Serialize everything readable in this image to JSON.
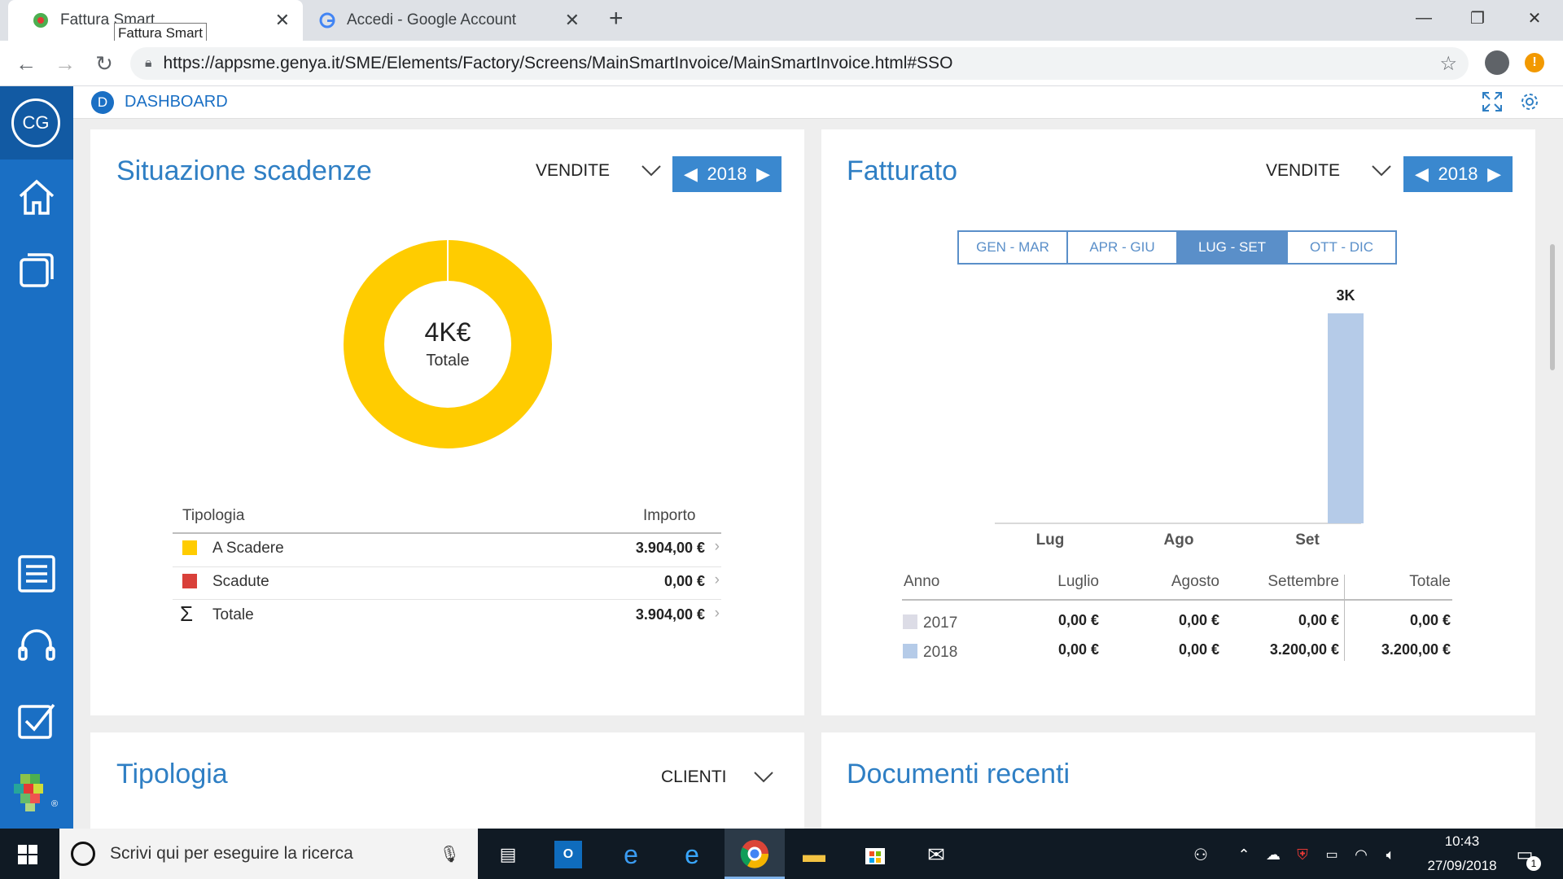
{
  "browser": {
    "tabs": [
      {
        "label": "Fattura Smart",
        "close": "✕"
      },
      {
        "label": "Accedi - Google Account",
        "close": "✕"
      }
    ],
    "new_tab": "+",
    "tooltip": "Fattura Smart",
    "url": "https://appsme.genya.it/SME/Elements/Factory/Screens/MainSmartInvoice/MainSmartInvoice.html#SSO",
    "window_controls": [
      "—",
      "❐",
      "✕"
    ]
  },
  "sidebar": {
    "avatar": "CG",
    "items": [
      "home-icon",
      "pages-icon",
      "list-icon",
      "headset-icon",
      "checkbox-icon"
    ]
  },
  "appbar": {
    "badge": "D",
    "title": "DASHBOARD"
  },
  "scadenze": {
    "title": "Situazione scadenze",
    "filter": "VENDITE",
    "year": "2018",
    "donut_value": "4K€",
    "donut_label": "Totale",
    "col_tipologia": "Tipologia",
    "col_importo": "Importo",
    "rows": [
      {
        "label": "A Scadere",
        "amount": "3.904,00 €",
        "color": "#ffcc00"
      },
      {
        "label": "Scadute",
        "amount": "0,00 €",
        "color": "#d9403a"
      },
      {
        "label": "Totale",
        "amount": "3.904,00 €",
        "symbol": "Σ"
      }
    ]
  },
  "fatturato": {
    "title": "Fatturato",
    "filter": "VENDITE",
    "year": "2018",
    "quarters": [
      "GEN - MAR",
      "APR - GIU",
      "LUG - SET",
      "OTT - DIC"
    ],
    "selected_quarter": "LUG - SET",
    "table_headers": [
      "Anno",
      "Luglio",
      "Agosto",
      "Settembre",
      "Totale"
    ],
    "table_rows": [
      {
        "anno": "2017",
        "luglio": "0,00 €",
        "agosto": "0,00 €",
        "settembre": "0,00 €",
        "totale": "0,00 €",
        "color": "#dcdce6"
      },
      {
        "anno": "2018",
        "luglio": "0,00 €",
        "agosto": "0,00 €",
        "settembre": "3.200,00 €",
        "totale": "3.200,00 €",
        "color": "#b5cbe8"
      }
    ]
  },
  "chart_data": [
    {
      "type": "pie",
      "title": "Situazione scadenze",
      "categories": [
        "A Scadere",
        "Scadute"
      ],
      "values": [
        3904,
        0
      ],
      "center_label": "4K€ Totale"
    },
    {
      "type": "bar",
      "title": "Fatturato",
      "categories": [
        "Lug",
        "Ago",
        "Set"
      ],
      "series": [
        {
          "name": "2017",
          "values": [
            0,
            0,
            0
          ]
        },
        {
          "name": "2018",
          "values": [
            0,
            0,
            3200
          ]
        }
      ],
      "data_labels": [
        "",
        "",
        "3K"
      ]
    }
  ],
  "tipologia": {
    "title": "Tipologia",
    "filter": "CLIENTI"
  },
  "documenti": {
    "title": "Documenti recenti"
  },
  "taskbar": {
    "search_placeholder": "Scrivi qui per eseguire la ricerca",
    "time": "10:43",
    "date": "27/09/2018",
    "notifications": "1"
  }
}
